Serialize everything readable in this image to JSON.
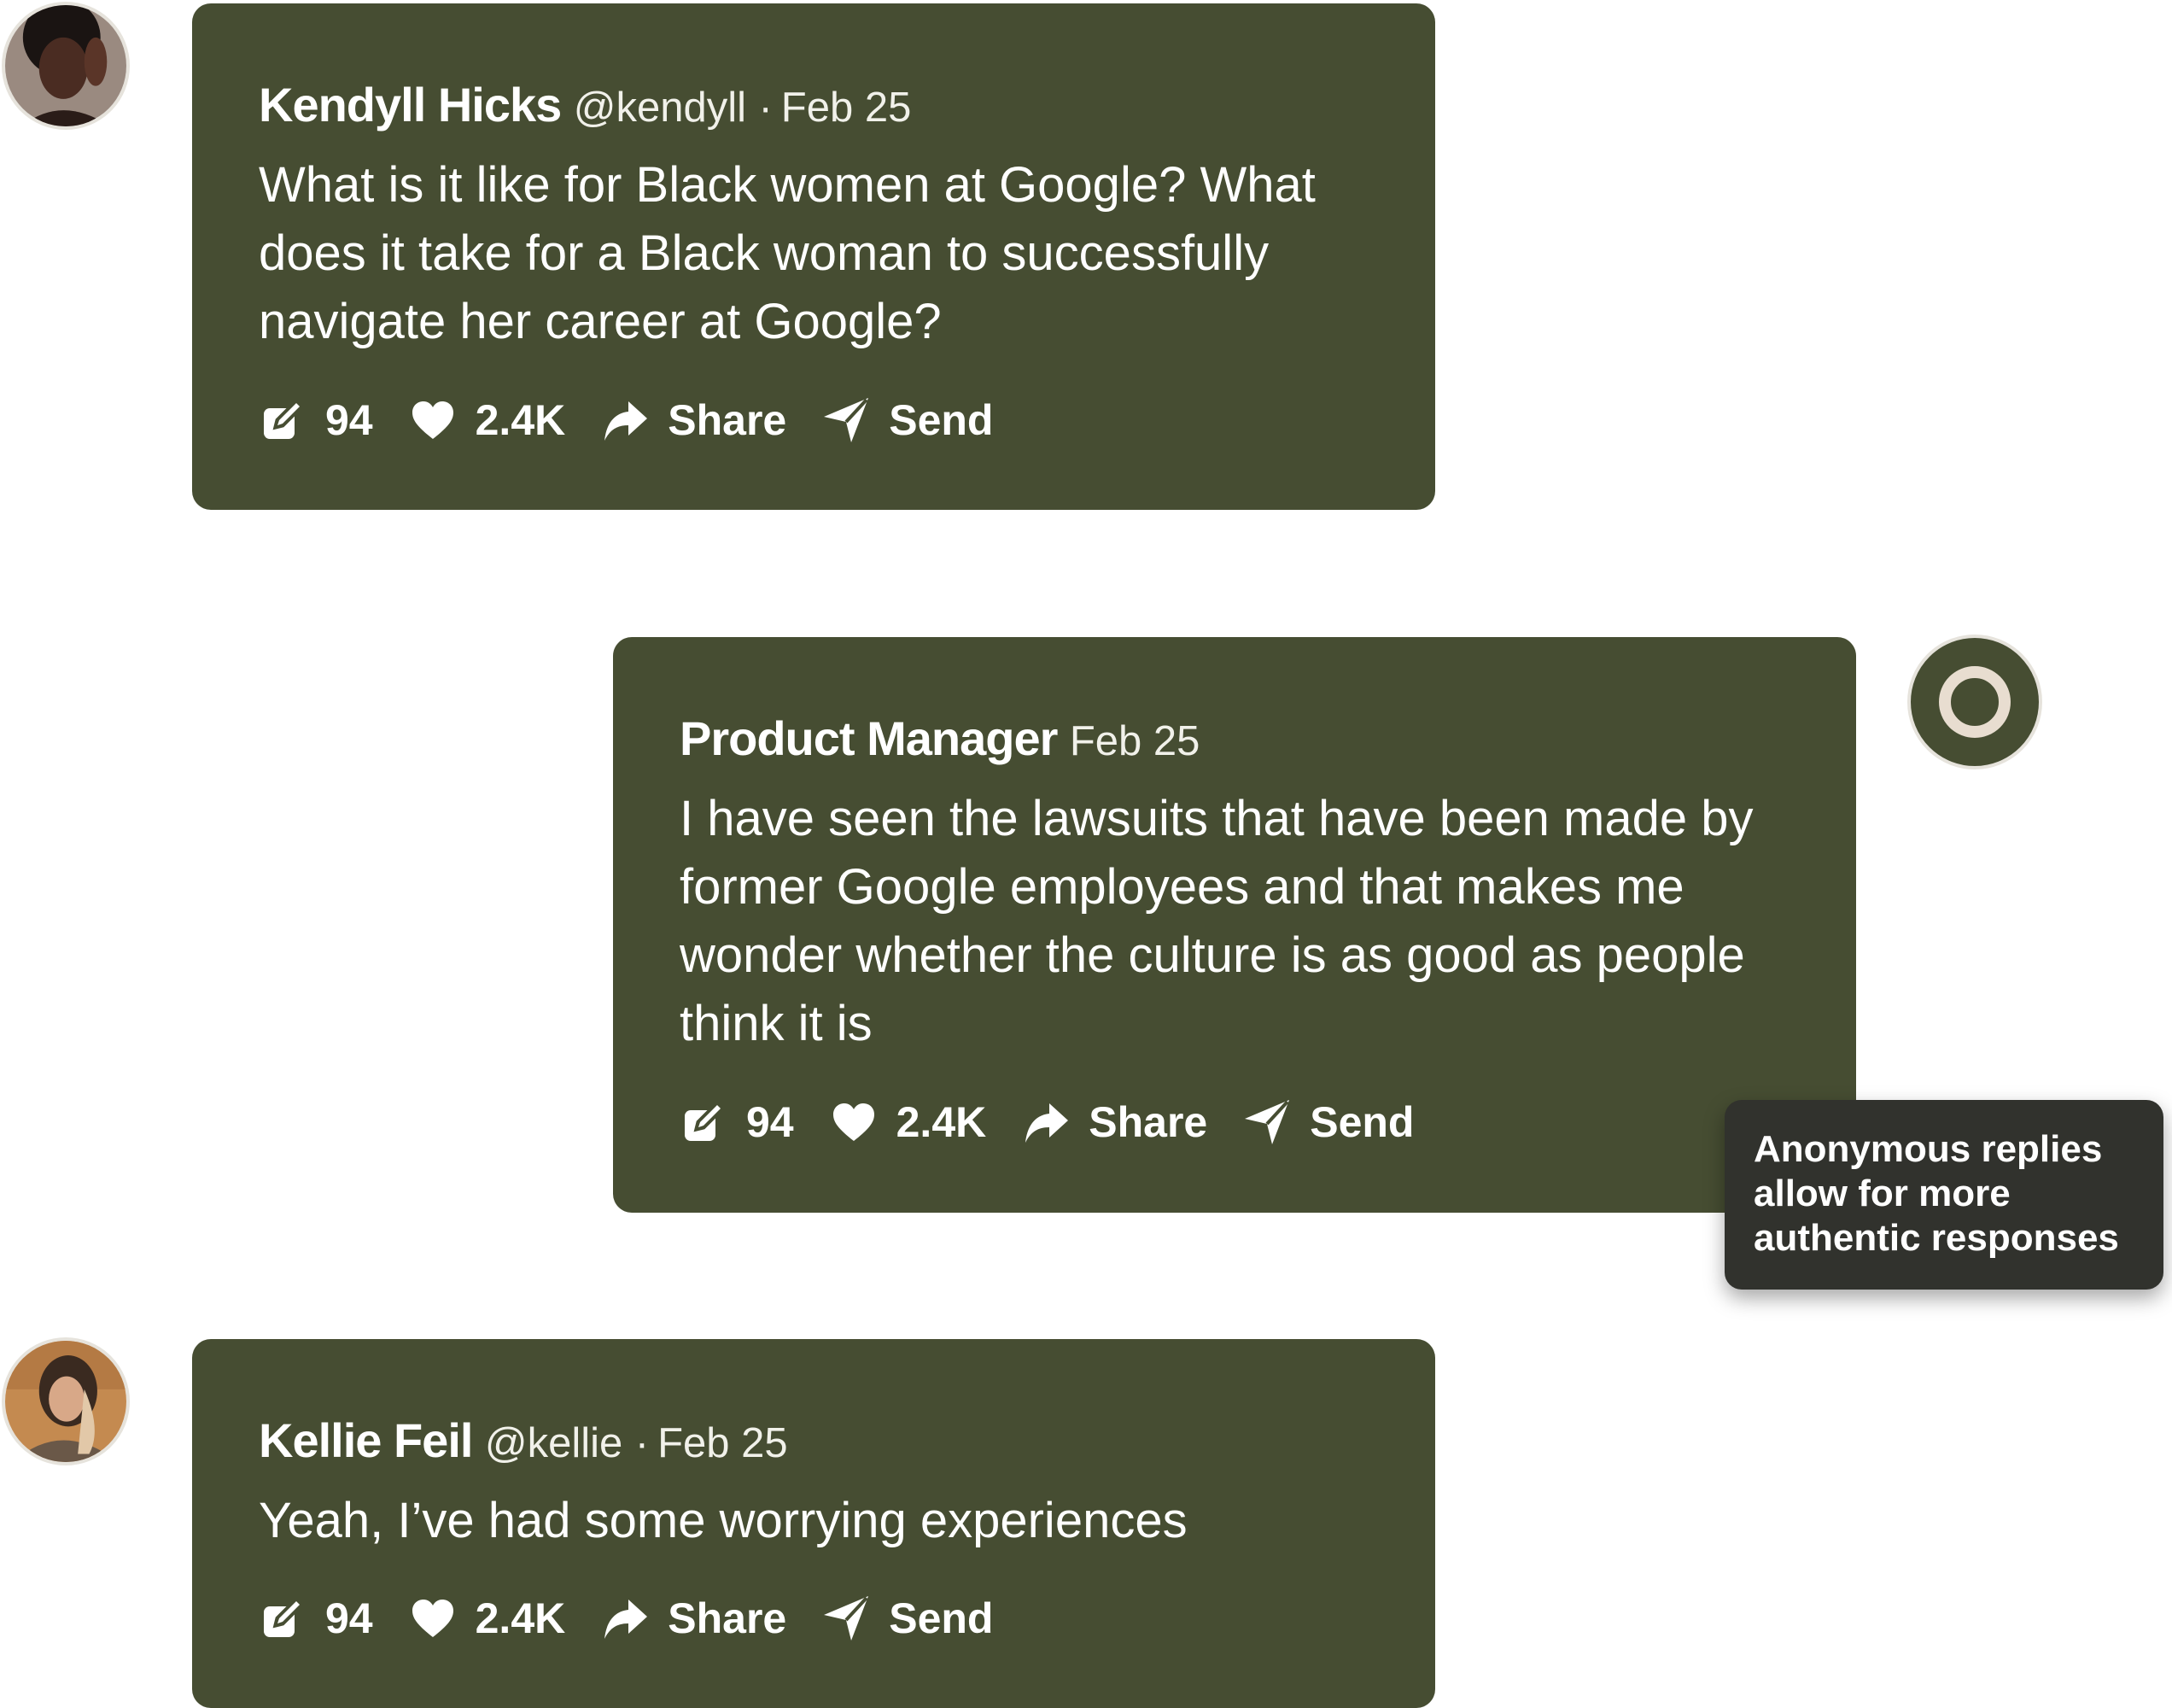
{
  "posts": [
    {
      "author": "Kendyll Hicks",
      "handle": "@kendyll",
      "separator": "·",
      "date": "Feb 25",
      "body": "What is it like for Black women at Google? What does it take for a Black woman to successfully navigate her career at Google?",
      "comments": "94",
      "likes": "2.4K",
      "share_label": "Share",
      "send_label": "Send"
    },
    {
      "author": "Product Manager",
      "date": "Feb 25",
      "body": "I have seen the lawsuits that have been made by former Google employees and that makes me wonder whether the culture is as good as people think it is",
      "comments": "94",
      "likes": "2.4K",
      "share_label": "Share",
      "send_label": "Send"
    },
    {
      "author": "Kellie Feil",
      "handle": "@kellie",
      "separator": "·",
      "date": "Feb 25",
      "body": "Yeah, I’ve had some worrying experiences",
      "comments": "94",
      "likes": "2.4K",
      "share_label": "Share",
      "send_label": "Send"
    }
  ],
  "tooltip": {
    "text": "Anonymous replies allow for more authentic responses"
  },
  "colors": {
    "card": "#464d32",
    "tooltip": "#31322d",
    "text": "#ffffff",
    "avatar_ring": "#e8ddd0"
  },
  "icons": [
    "comment-icon",
    "heart-icon",
    "share-icon",
    "send-icon",
    "anonymous-ring-icon"
  ]
}
